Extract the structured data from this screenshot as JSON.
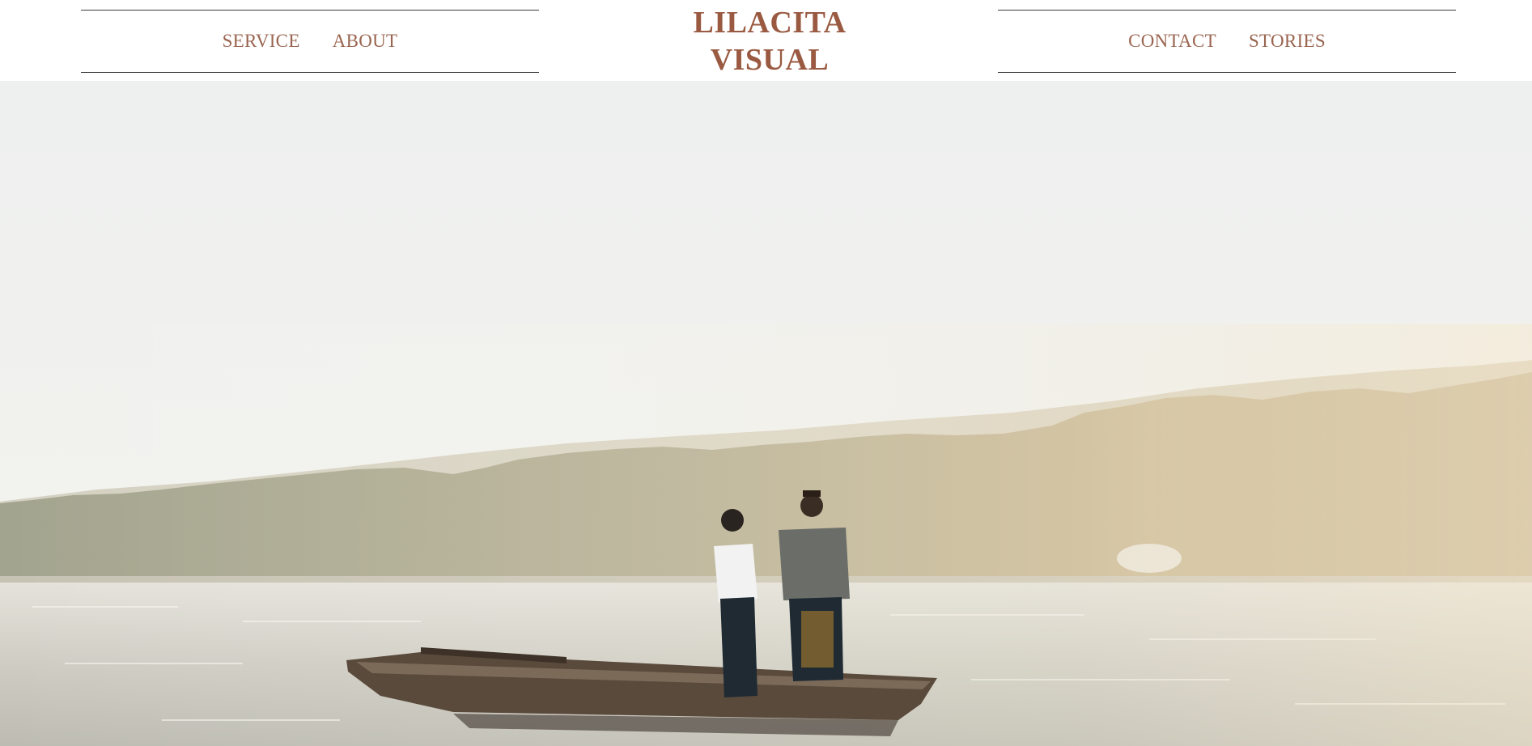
{
  "nav": {
    "left": [
      {
        "label": "SERVICE"
      },
      {
        "label": "ABOUT"
      }
    ],
    "right": [
      {
        "label": "CONTACT"
      },
      {
        "label": "STORIES"
      }
    ]
  },
  "logo": {
    "line1": "LILACITA",
    "line2": "VISUAL"
  },
  "colors": {
    "accent": "#9a6550",
    "logo": "#9a5a42",
    "rule": "#3a3a3a"
  }
}
